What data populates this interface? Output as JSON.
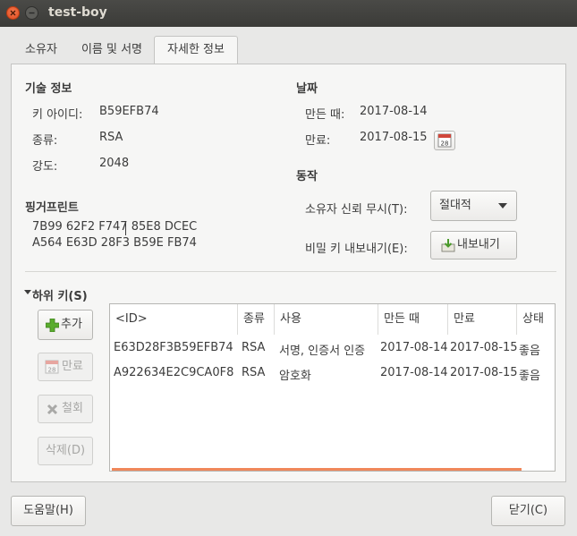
{
  "window": {
    "title": "test-boy"
  },
  "tabs": [
    {
      "label": "소유자"
    },
    {
      "label": "이름 및 서명"
    },
    {
      "label": "자세한 정보"
    }
  ],
  "tech_info": {
    "heading": "기술 정보",
    "key_id_label": "키 아이디:",
    "key_id_value": "B59EFB74",
    "type_label": "종류:",
    "type_value": "RSA",
    "strength_label": "강도:",
    "strength_value": "2048"
  },
  "fingerprint": {
    "heading": "핑거프린트",
    "line1": "7B99 62F2 F747 85E8 DCEC",
    "line2": "A564 E63D 28F3 B59E FB74"
  },
  "dates": {
    "heading": "날짜",
    "created_label": "만든 때:",
    "created_value": "2017-08-14",
    "expires_label": "만료:",
    "expires_value": "2017-08-15",
    "calendar_icon_text": "28"
  },
  "actions": {
    "heading": "동작",
    "trust_label": "소유자 신뢰 무시(T):",
    "trust_value": "절대적",
    "export_label": "비밀 키 내보내기(E):",
    "export_button": "내보내기"
  },
  "subkeys": {
    "heading": "하위 키(S)",
    "add_button": "추가",
    "expire_button": "만료",
    "revoke_button": "철회",
    "delete_button": "삭제(D)",
    "columns": [
      "<ID>",
      "종류",
      "사용",
      "만든 때",
      "만료",
      "상태"
    ],
    "rows": [
      [
        "E63D28F3B59EFB74",
        "RSA",
        "서명, 인증서 인증",
        "2017-08-14",
        "2017-08-15",
        "좋음"
      ],
      [
        "A922634E2C9CA0F8",
        "RSA",
        "암호화",
        "2017-08-14",
        "2017-08-15",
        "좋음"
      ]
    ]
  },
  "footer": {
    "help_button": "도움말(H)",
    "close_button": "닫기(C)"
  },
  "colors": {
    "accent": "#f0875a",
    "title_bar": "#3c3b37",
    "close_button": "#e9541f"
  },
  "icons": [
    "close-icon",
    "minimize-icon",
    "calendar-icon",
    "dropdown-arrow-icon",
    "export-icon",
    "add-icon",
    "revoke-icon",
    "expander-arrow-icon"
  ]
}
